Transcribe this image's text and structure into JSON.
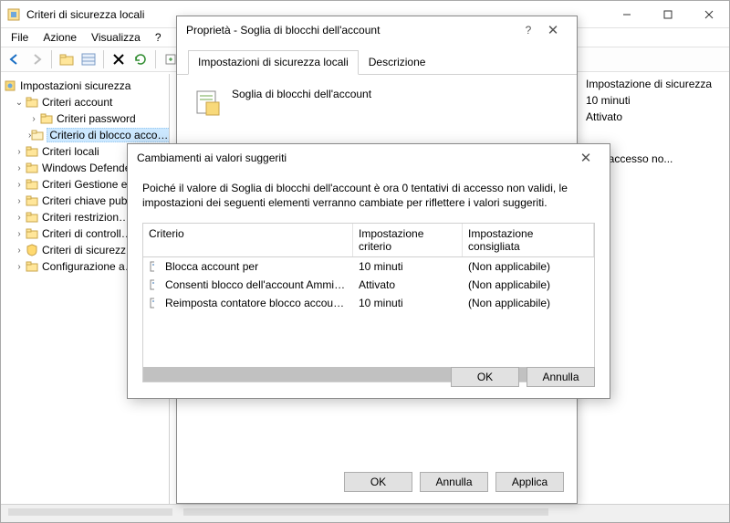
{
  "window": {
    "title": "Criteri di sicurezza locali"
  },
  "menu": {
    "file": "File",
    "azione": "Azione",
    "visualizza": "Visualizza",
    "help": "?"
  },
  "tree": {
    "root": "Impostazioni sicurezza",
    "criteri_account": "Criteri account",
    "criteri_password": "Criteri password",
    "criteri_blocco": "Criterio di blocco acco…",
    "criteri_locali": "Criteri locali",
    "windows_defender": "Windows Defender …",
    "criteri_gestione": "Criteri Gestione el…",
    "criteri_chiave": "Criteri chiave pub…",
    "criteri_restrizion": "Criteri restrizion…",
    "criteri_controllo": "Criteri di controll…",
    "criteri_sicurezza": "Criteri di sicurezz…",
    "configurazione": "Configurazione a…"
  },
  "right": {
    "header": "Impostazione di sicurezza",
    "v1": "10 minuti",
    "v2": "Attivato",
    "v3": "vi di accesso no..."
  },
  "props": {
    "title": "Proprietà - Soglia di blocchi dell'account",
    "tab1": "Impostazioni di sicurezza locali",
    "tab2": "Descrizione",
    "label": "Soglia di blocchi dell'account",
    "ok": "OK",
    "annulla": "Annulla",
    "applica": "Applica"
  },
  "inner": {
    "title": "Cambiamenti ai valori suggeriti",
    "msg": "Poiché il valore di Soglia di blocchi dell'account è ora 0 tentativi di accesso non validi, le impostazioni dei seguenti elementi verranno cambiate per riflettere i valori suggeriti.",
    "col1": "Criterio",
    "col2": "Impostazione criterio",
    "col3": "Impostazione consigliata",
    "rows": [
      {
        "c": "Blocca account per",
        "v": "10 minuti",
        "r": "(Non applicabile)"
      },
      {
        "c": "Consenti blocco dell'account Amministr...",
        "v": "Attivato",
        "r": "(Non applicabile)"
      },
      {
        "c": "Reimposta contatore blocco account do...",
        "v": "10 minuti",
        "r": "(Non applicabile)"
      }
    ],
    "ok": "OK",
    "annulla": "Annulla"
  }
}
